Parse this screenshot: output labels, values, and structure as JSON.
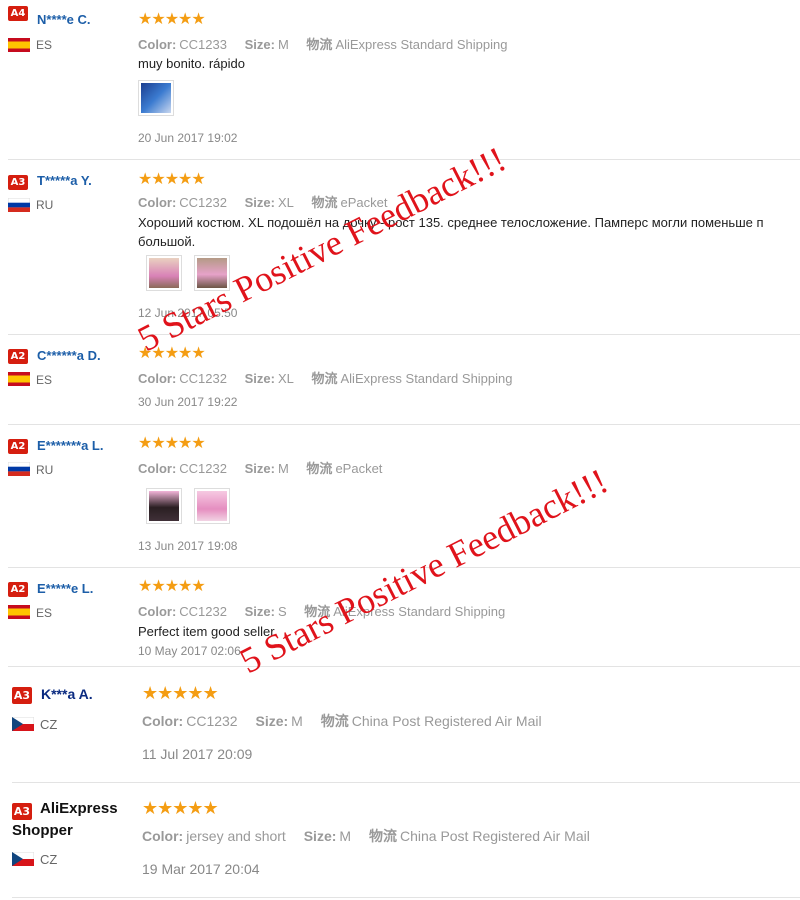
{
  "labels": {
    "color": "Color:",
    "size": "Size:",
    "logistics": "物流"
  },
  "reviews": [
    {
      "level": "A4",
      "name": "N****e C.",
      "country": "ES",
      "stars": "★★★★★",
      "color": "CC1233",
      "size": "M",
      "shipping": "AliExpress Standard Shipping",
      "comment": "muy bonito. rápido",
      "date": "20 Jun 2017 19:02"
    },
    {
      "level": "A3",
      "name": "T*****a Y.",
      "country": "RU",
      "stars": "★★★★★",
      "color": "CC1232",
      "size": "XL",
      "shipping": "ePacket",
      "comment": "Хороший костюм. XL подошёл на дочку - рост 135. среднее телосложение. Памперс могли поменьше п большой.",
      "date": "12 Jun 2017 05:50"
    },
    {
      "level": "A2",
      "name": "C******a D.",
      "country": "ES",
      "stars": "★★★★★",
      "color": "CC1232",
      "size": "XL",
      "shipping": "AliExpress Standard Shipping",
      "date": "30 Jun 2017 19:22"
    },
    {
      "level": "A2",
      "name": "E*******a L.",
      "country": "RU",
      "stars": "★★★★★",
      "color": "CC1232",
      "size": "M",
      "shipping": "ePacket",
      "date": "13 Jun 2017 19:08"
    },
    {
      "level": "A2",
      "name": "E*****e L.",
      "country": "ES",
      "stars": "★★★★★",
      "color": "CC1232",
      "size": "S",
      "shipping": "AliExpress Standard Shipping",
      "comment": "Perfect item good seller",
      "date": "10 May 2017 02:06"
    },
    {
      "level": "A3",
      "name": "K***a A.",
      "country": "CZ",
      "stars": "★★★★★",
      "color": "CC1232",
      "size": "M",
      "shipping": "China Post Registered Air Mail",
      "date": "11 Jul 2017 20:09"
    },
    {
      "level": "A3",
      "name": "AliExpress Shopper",
      "country": "CZ",
      "stars": "★★★★★",
      "color": "jersey and short",
      "size": "M",
      "shipping": "China Post Registered Air Mail",
      "date": "19 Mar 2017 20:04"
    }
  ],
  "watermark": {
    "text": "5 Stars Positive Feedback!!!",
    "color": "#e0131b"
  },
  "colors": {
    "level_badge": "#d51e0f",
    "stars": "#f49d13",
    "username": "#1c5ea8"
  }
}
